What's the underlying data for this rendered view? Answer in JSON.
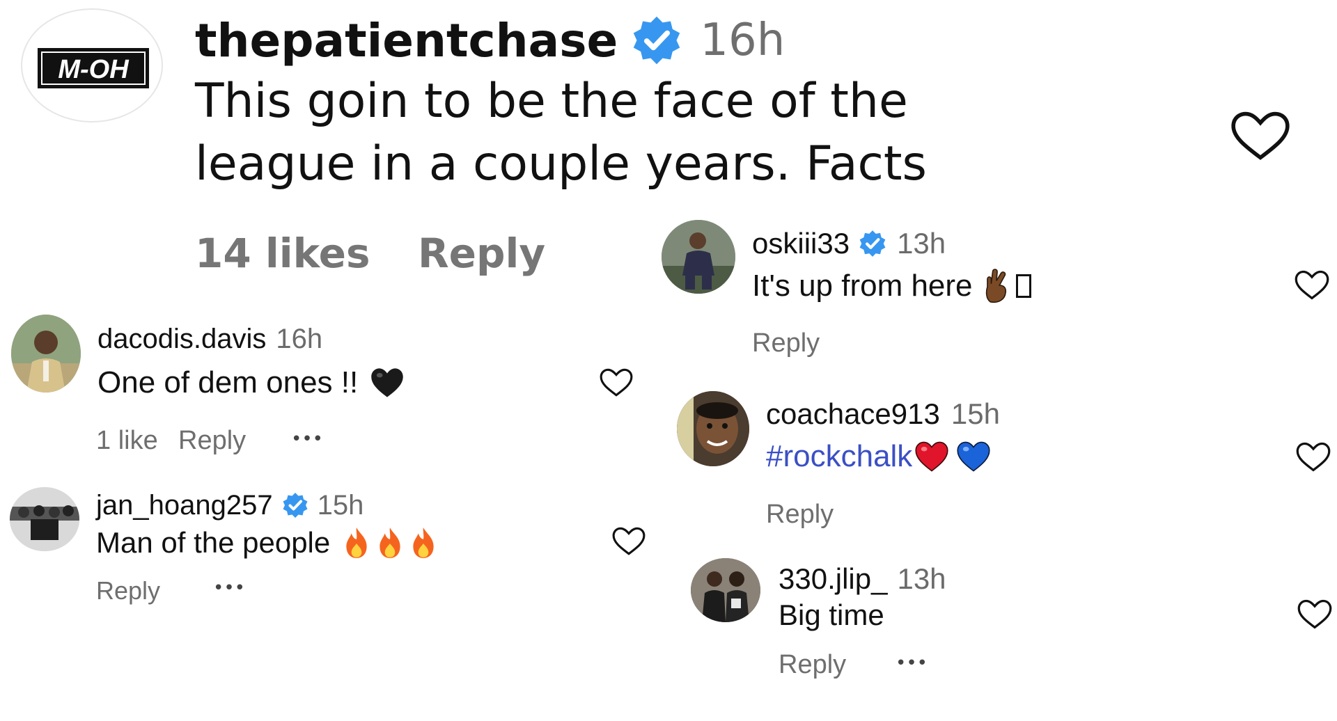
{
  "main_comment": {
    "avatar_logo_text": "M-OH",
    "username": "thepatientchase",
    "time": "16h",
    "text_line1": "This goin to be the face of the",
    "text_line2": "league in a couple years. Facts",
    "likes": "14 likes",
    "reply": "Reply"
  },
  "left_replies": [
    {
      "username": "dacodis.davis",
      "time": "16h",
      "text": "One of dem ones !!",
      "likes": "1 like",
      "reply": "Reply",
      "more": "•••"
    },
    {
      "username": "jan_hoang257",
      "time": "15h",
      "text": "Man of the people",
      "reply": "Reply",
      "more": "•••"
    }
  ],
  "right_replies": [
    {
      "username": "oskiii33",
      "time": "13h",
      "text": "It's up from here",
      "reply": "Reply"
    },
    {
      "username": "coachace913",
      "time": "15h",
      "text": "#rockchalk",
      "reply": "Reply"
    },
    {
      "username": "330.jlip_",
      "time": "13h",
      "text": "Big time",
      "reply": "Reply",
      "more": "•••"
    }
  ],
  "colors": {
    "verified": "#3797f0",
    "hashtag": "#3b4fc4",
    "meta": "#6e6e6e",
    "heart_red": "#e0142a",
    "heart_blue": "#1b63d8",
    "heart_black": "#1a1a1a",
    "fire": "#f5641e"
  }
}
